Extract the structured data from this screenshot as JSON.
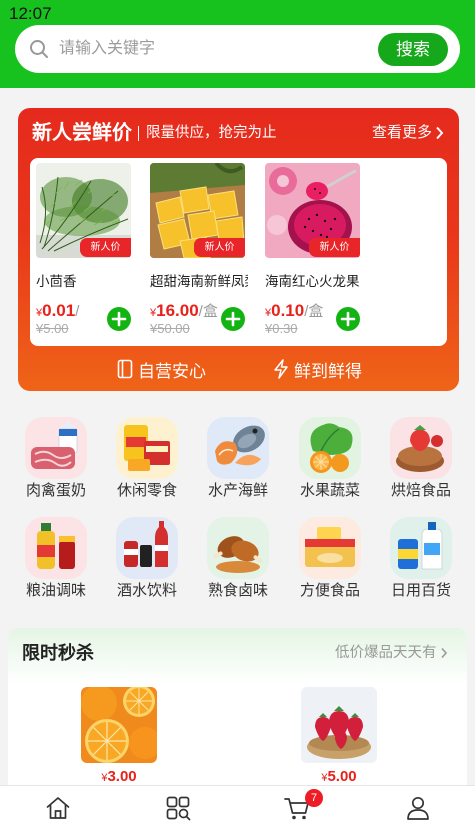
{
  "status_bar": {
    "time": "12:07"
  },
  "search": {
    "placeholder": "请输入关键字",
    "button_label": "搜索",
    "icon": "search-icon"
  },
  "newcomer": {
    "title": "新人尝鲜价",
    "subtitle": "限量供应，抢完为止",
    "more_label": "查看更多",
    "badge_label": "新人价",
    "products": [
      {
        "name": "小茴香",
        "currency": "¥",
        "price": "0.01",
        "unit": "/",
        "original_price": "¥5.00",
        "image": "dill"
      },
      {
        "name": "超甜海南新鲜凤梨",
        "currency": "¥",
        "price": "16.00",
        "unit": "/盒",
        "original_price": "¥50.00",
        "image": "pineapple"
      },
      {
        "name": "海南红心火龙果",
        "currency": "¥",
        "price": "0.10",
        "unit": "/盒",
        "original_price": "¥0.30",
        "image": "dragon-fruit"
      }
    ],
    "promises": [
      {
        "label": "自营安心",
        "icon": "book-icon"
      },
      {
        "label": "鲜到鲜得",
        "icon": "lightning-icon"
      }
    ]
  },
  "categories": [
    {
      "label": "肉禽蛋奶",
      "icon": "meat-and-milk"
    },
    {
      "label": "休闲零食",
      "icon": "snacks"
    },
    {
      "label": "水产海鲜",
      "icon": "seafood"
    },
    {
      "label": "水果蔬菜",
      "icon": "fruit-and-vegetables"
    },
    {
      "label": "烘焙食品",
      "icon": "bakery"
    },
    {
      "label": "粮油调味",
      "icon": "oil-and-seasoning"
    },
    {
      "label": "酒水饮料",
      "icon": "drinks"
    },
    {
      "label": "熟食卤味",
      "icon": "deli"
    },
    {
      "label": "方便食品",
      "icon": "instant-food"
    },
    {
      "label": "日用百货",
      "icon": "daily-goods"
    }
  ],
  "flash_sale": {
    "title": "限时秒杀",
    "more_label": "低价爆品天天有",
    "products": [
      {
        "currency": "¥",
        "price": "3.00",
        "image": "oranges"
      },
      {
        "currency": "¥",
        "price": "5.00",
        "image": "strawberries"
      }
    ]
  },
  "tab_bar": {
    "items": [
      {
        "icon": "home-icon"
      },
      {
        "icon": "category-icon"
      },
      {
        "icon": "cart-icon",
        "badge": "7"
      },
      {
        "icon": "user-icon"
      }
    ]
  },
  "colors": {
    "brand_green": "#18c21e",
    "button_green": "#15a81a",
    "promo_red": "#e52a1d",
    "promo_orange": "#ef6418",
    "price_red": "#e8211a",
    "badge_red": "#ee1c25"
  }
}
